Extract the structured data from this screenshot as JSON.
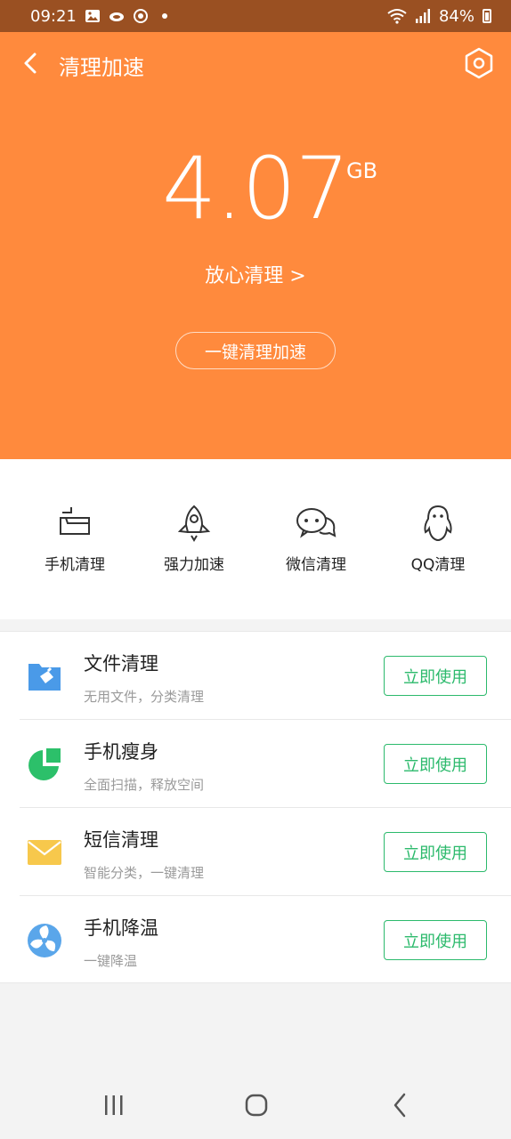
{
  "status_bar": {
    "time": "09:21",
    "battery": "84%"
  },
  "header": {
    "title": "清理加速"
  },
  "hero": {
    "value": "4.07",
    "unit": "GB",
    "safe_clean": "放心清理 >",
    "one_key_button": "一键清理加速",
    "background_color": "#ff8a3d"
  },
  "quick_actions": [
    {
      "label": "手机清理",
      "icon": "phone-clean-icon"
    },
    {
      "label": "强力加速",
      "icon": "rocket-icon"
    },
    {
      "label": "微信清理",
      "icon": "wechat-icon"
    },
    {
      "label": "QQ清理",
      "icon": "qq-icon"
    }
  ],
  "tools": [
    {
      "title": "文件清理",
      "subtitle": "无用文件，分类清理",
      "button": "立即使用",
      "icon": "file-folder-icon"
    },
    {
      "title": "手机瘦身",
      "subtitle": "全面扫描，释放空间",
      "button": "立即使用",
      "icon": "pie-chart-icon"
    },
    {
      "title": "短信清理",
      "subtitle": "智能分类，一键清理",
      "button": "立即使用",
      "icon": "envelope-icon"
    },
    {
      "title": "手机降温",
      "subtitle": "一键降温",
      "button": "立即使用",
      "icon": "fan-icon"
    }
  ],
  "accent_color": "#2cba6c"
}
